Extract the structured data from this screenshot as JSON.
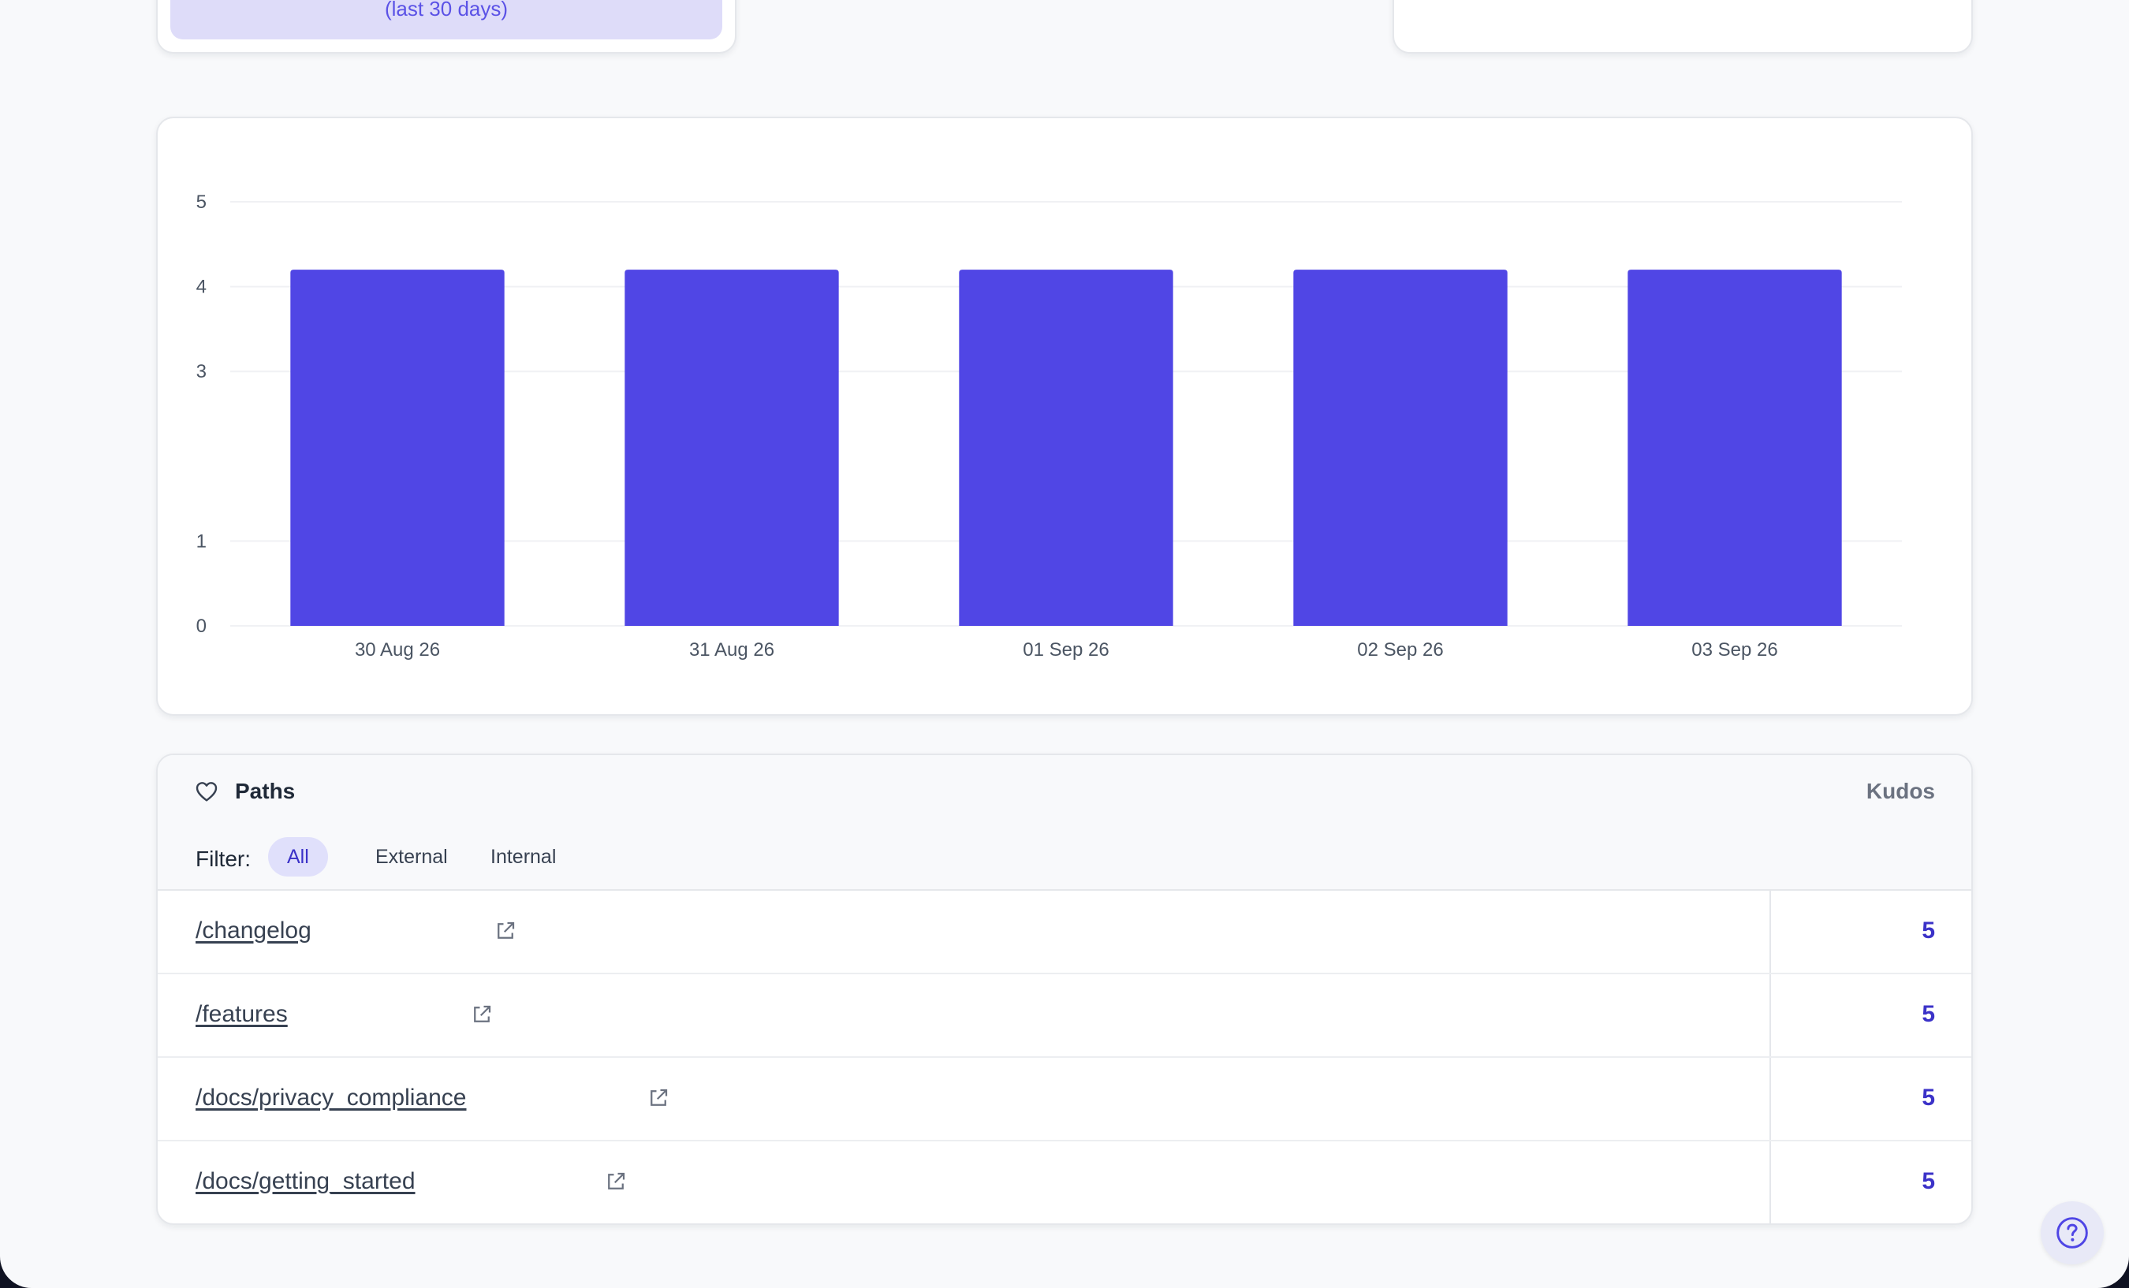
{
  "summary_cards": {
    "left_subtitle": "(last 30 days)"
  },
  "chart_data": {
    "type": "bar",
    "categories": [
      "30 Aug 26",
      "31 Aug 26",
      "01 Sep 26",
      "02 Sep 26",
      "03 Sep 26"
    ],
    "values": [
      4.2,
      4.2,
      4.2,
      4.2,
      4.2
    ],
    "y_ticks": [
      "0",
      "1",
      "3",
      "4",
      "5"
    ],
    "ylim": [
      0,
      5
    ],
    "grid": true,
    "bar_color": "#5046e5"
  },
  "paths": {
    "title": "Paths",
    "kudos_header": "Kudos",
    "filter_label": "Filter:",
    "filters": [
      "All",
      "External",
      "Internal"
    ],
    "active_filter": "All",
    "rows": [
      {
        "path": "/changelog",
        "kudos": "5"
      },
      {
        "path": "/features",
        "kudos": "5"
      },
      {
        "path": "/docs/privacy_compliance",
        "kudos": "5"
      },
      {
        "path": "/docs/getting_started",
        "kudos": "5"
      }
    ]
  },
  "colors": {
    "accent": "#5046e5",
    "kudos_value": "#3b32c8",
    "pill_active_bg": "#e0e0fb"
  },
  "icons": {
    "paths_header": "heart-icon",
    "row_link": "external-link-icon",
    "help": "help-circle-icon"
  }
}
